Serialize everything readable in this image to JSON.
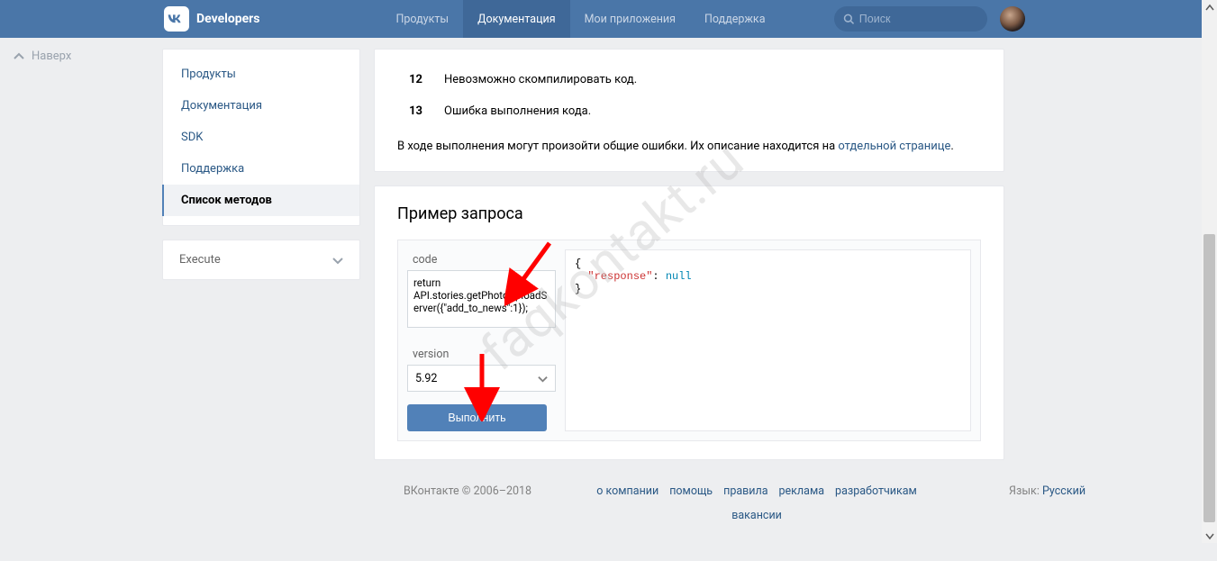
{
  "header": {
    "brand": "Developers",
    "nav": [
      "Продукты",
      "Документация",
      "Мои приложения",
      "Поддержка"
    ],
    "nav_active": 1,
    "search_placeholder": "Поиск"
  },
  "backtop": "Наверх",
  "sidebar": {
    "items": [
      "Продукты",
      "Документация",
      "SDK",
      "Поддержка",
      "Список методов"
    ],
    "active": 4
  },
  "execute_box": "Execute",
  "errors": [
    {
      "code": "12",
      "text": "Невозможно скомпилировать код."
    },
    {
      "code": "13",
      "text": "Ошибка выполнения кода."
    }
  ],
  "errors_info_prefix": "В ходе выполнения могут произойти общие ошибки. Их описание находится на ",
  "errors_info_link": "отдельной странице",
  "errors_info_suffix": ".",
  "example": {
    "title": "Пример запроса",
    "code_label": "code",
    "code_value": "return API.stories.getPhotoUploadServer({\"add_to_news\":1});",
    "version_label": "version",
    "version_value": "5.92",
    "run": "Выполнить",
    "response_key": "\"response\"",
    "response_val": "null"
  },
  "footer": {
    "copyright": "ВКонтакте © 2006–2018",
    "links": [
      "о компании",
      "помощь",
      "правила",
      "реклама",
      "разработчикам",
      "вакансии"
    ],
    "lang_label": "Язык:",
    "lang_value": "Русский"
  },
  "watermark": "faqkontakt.ru"
}
